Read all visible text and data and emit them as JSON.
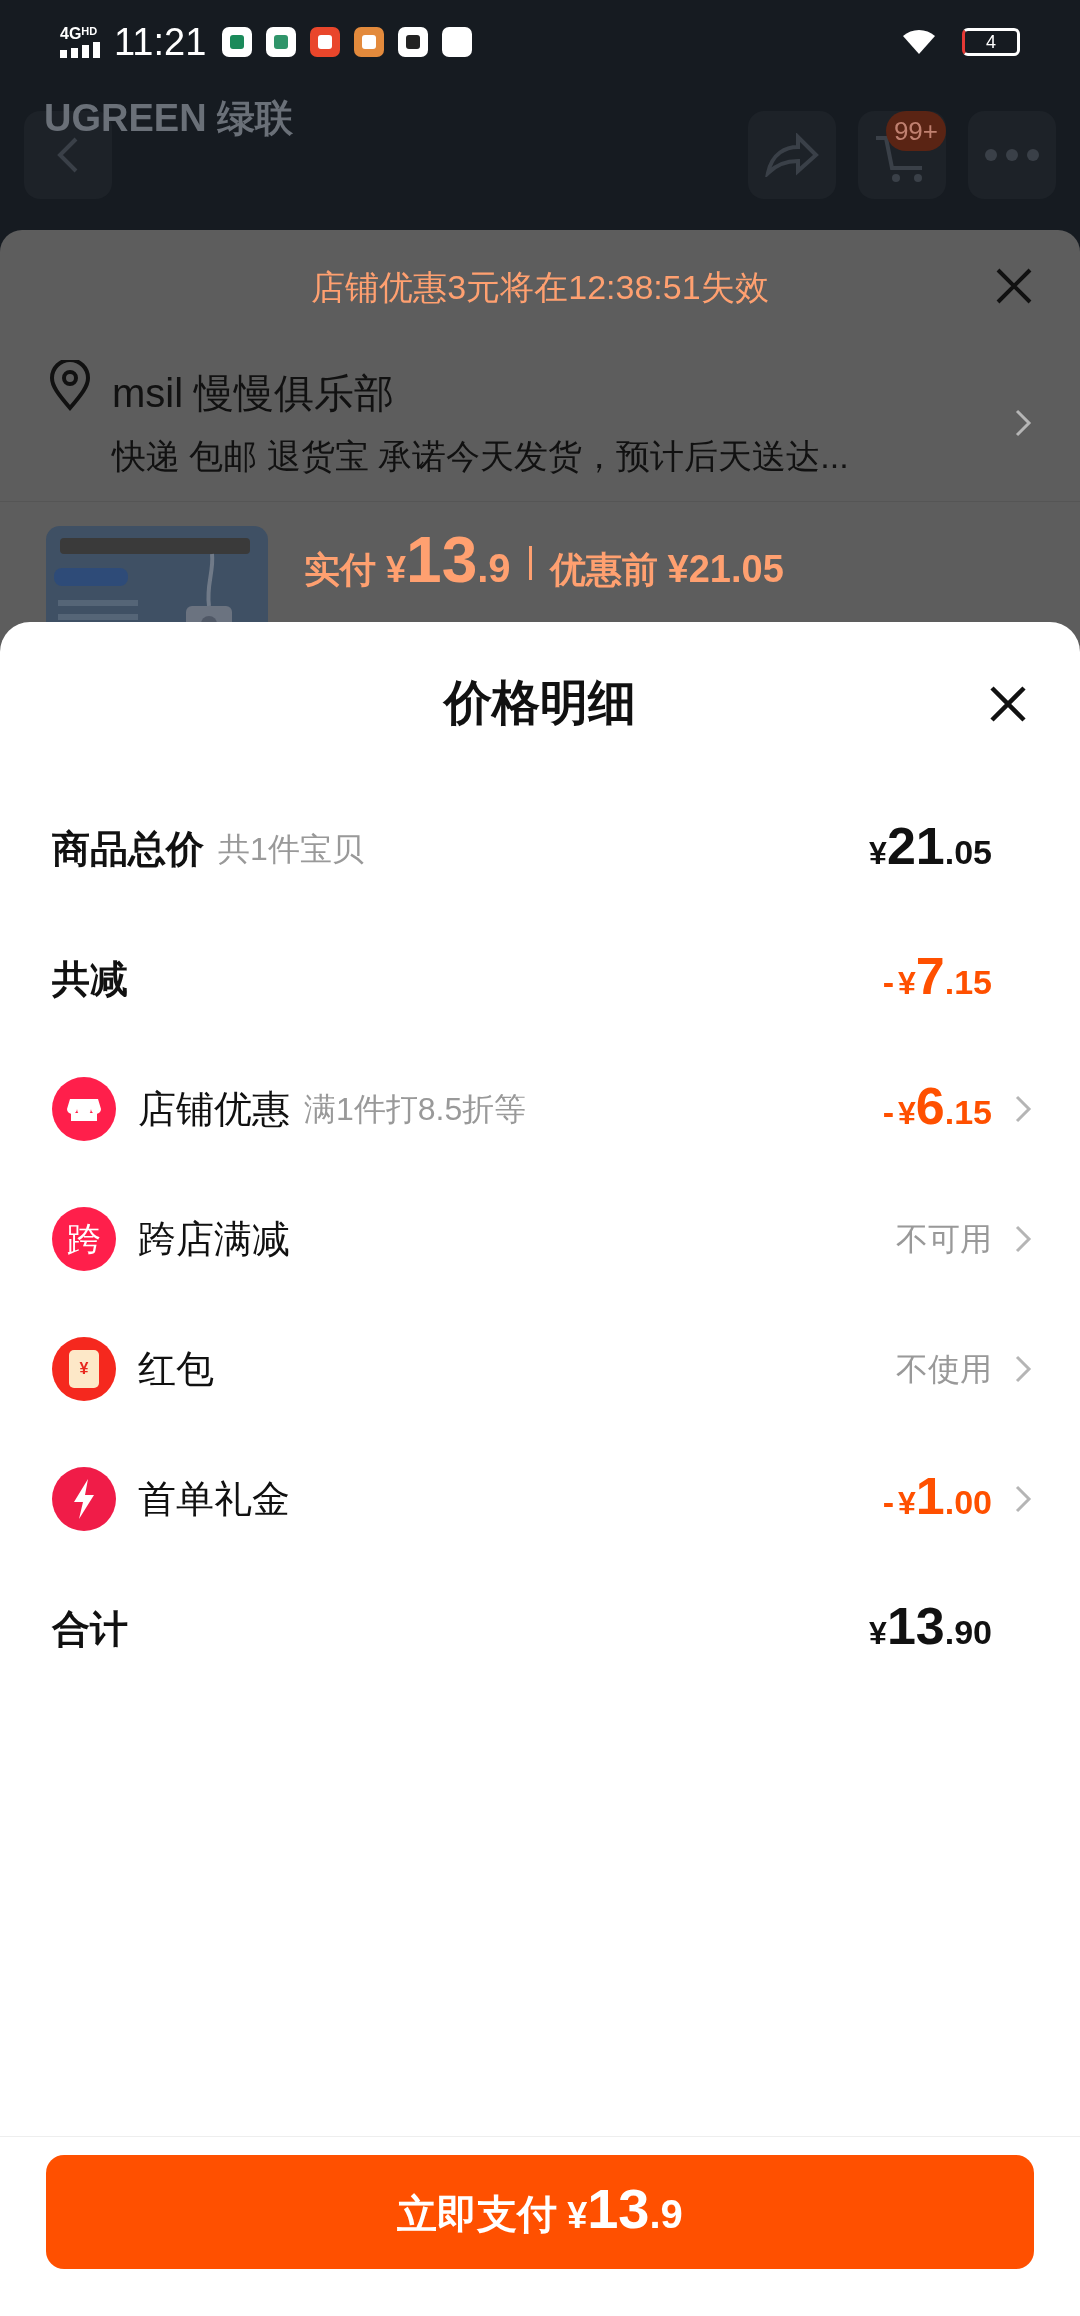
{
  "status_bar": {
    "network": "4G",
    "network_badge": "HD",
    "time": "11:21",
    "battery": "4"
  },
  "header": {
    "logo": "UGREEN 绿联",
    "cart_badge": "99+"
  },
  "order_sheet": {
    "countdown": "店铺优惠3元将在12:38:51失效",
    "address_name": "msil 慢慢俱乐部",
    "delivery": "快递 包邮 退货宝 承诺今天发货，预计后天送达...",
    "price_label": "实付",
    "price_currency": "¥",
    "price_integer": "13",
    "price_decimal": ".9",
    "original_label": "优惠前",
    "original_price": "¥21.05"
  },
  "price_detail": {
    "title": "价格明细",
    "rows": [
      {
        "kind": "summary",
        "label": "商品总价",
        "note": "共1件宝贝",
        "amount": {
          "currency": "¥",
          "integer": "21",
          "decimal": ".05"
        }
      },
      {
        "kind": "summary",
        "label": "共减",
        "amount": {
          "sign": "-",
          "currency": "¥",
          "integer": "7",
          "decimal": ".15"
        }
      },
      {
        "kind": "item",
        "label": "店铺优惠",
        "note": "满1件打8.5折等",
        "amount": {
          "sign": "-",
          "currency": "¥",
          "integer": "6",
          "decimal": ".15"
        }
      },
      {
        "kind": "item",
        "label": "跨店满减",
        "icon_text": "跨",
        "status": "不可用"
      },
      {
        "kind": "item",
        "label": "红包",
        "icon_text": "¥",
        "status": "不使用"
      },
      {
        "kind": "item",
        "label": "首单礼金",
        "amount": {
          "sign": "-",
          "currency": "¥",
          "integer": "1",
          "decimal": ".00"
        }
      },
      {
        "kind": "summary",
        "label": "合计",
        "amount": {
          "currency": "¥",
          "integer": "13",
          "decimal": ".90"
        }
      }
    ]
  },
  "pay_button": {
    "label": "立即支付",
    "currency": "¥",
    "integer": "13",
    "decimal": ".9"
  }
}
